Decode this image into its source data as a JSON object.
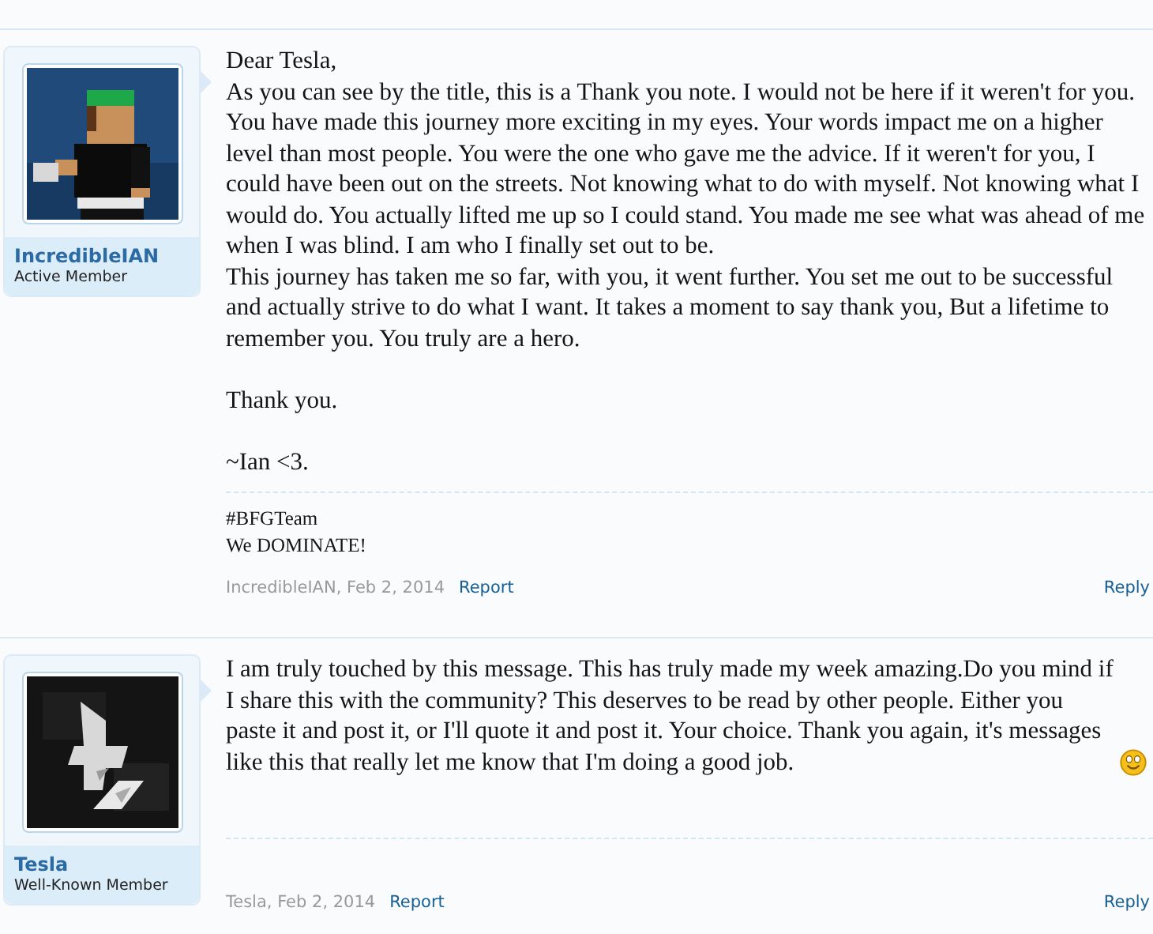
{
  "posts": [
    {
      "user": {
        "name": "IncredibleIAN",
        "title": "Active Member"
      },
      "message": [
        [
          "Dear Tesla,",
          "As you can see by the title, this is a Thank you note. I would not be here if it weren't for you. You have made this journey more exciting in my eyes. Your words impact me on a higher level than most people. You were the one who gave me the advice. If it weren't for you, I could have been out on the streets. Not knowing what to do with myself. Not knowing what I would do. You actually lifted me up so I could stand. You made me see what was ahead of me when I was blind. I am who I finally set out to be.",
          "This journey has taken me so far, with you, it went further. You set me out to be successful and actually strive to do what I want. It takes a moment to say thank you, But a lifetime to remember you. You truly are a hero."
        ],
        [
          "Thank you."
        ],
        [
          "~Ian <3."
        ]
      ],
      "smiley": false,
      "signature": [
        "#BFGTeam",
        "We DOMINATE!"
      ],
      "meta": "IncredibleIAN, Feb 2, 2014",
      "report": "Report",
      "reply": "Reply"
    },
    {
      "user": {
        "name": "Tesla",
        "title": "Well-Known Member"
      },
      "message": [
        [
          "I am truly touched by this message. This has truly made my week amazing.Do you mind if I share this with the community? This deserves to be read by other people. Either you paste it and post it, or I'll quote it and post it. Your choice. Thank you again, it's messages like this that really let me know that I'm doing a good job."
        ]
      ],
      "smiley": true,
      "meta": "Tesla, Feb 2, 2014",
      "report": "Report",
      "reply": "Reply"
    }
  ]
}
